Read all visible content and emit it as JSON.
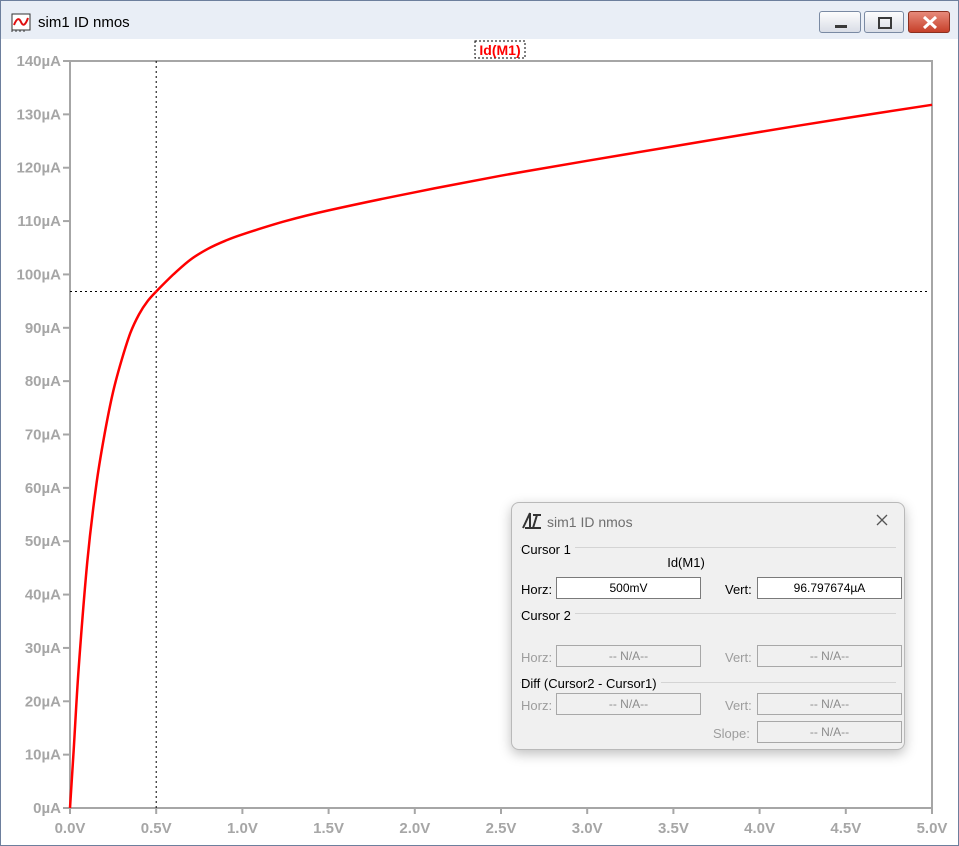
{
  "window": {
    "title": "sim1 ID nmos",
    "icon": "waveform-viewer-icon"
  },
  "plot": {
    "trace_label": "Id(M1)",
    "trace_color": "#ff0000",
    "tick_color": "#a6a6a6",
    "cursor": {
      "x": 0.5,
      "y": 96.797674
    }
  },
  "chart_data": {
    "type": "line",
    "xlim": [
      0,
      5
    ],
    "ylim": [
      0,
      140
    ],
    "x_ticks": [
      "0.0V",
      "0.5V",
      "1.0V",
      "1.5V",
      "2.0V",
      "2.5V",
      "3.0V",
      "3.5V",
      "4.0V",
      "4.5V",
      "5.0V"
    ],
    "y_ticks": [
      "0µA",
      "10µA",
      "20µA",
      "30µA",
      "40µA",
      "50µA",
      "60µA",
      "70µA",
      "80µA",
      "90µA",
      "100µA",
      "110µA",
      "120µA",
      "130µA",
      "140µA"
    ],
    "grid": false,
    "series": [
      {
        "name": "Id(M1)",
        "color": "#ff0000",
        "x": [
          0,
          0.02,
          0.05,
          0.1,
          0.15,
          0.2,
          0.25,
          0.3,
          0.35,
          0.4,
          0.45,
          0.5,
          0.6,
          0.7,
          0.8,
          0.9,
          1.0,
          1.25,
          1.5,
          2.0,
          2.5,
          3.0,
          3.5,
          4.0,
          4.5,
          5.0
        ],
        "values": [
          0,
          10,
          26,
          46,
          60,
          70,
          78,
          84,
          89,
          92.5,
          95,
          96.8,
          100,
          102.8,
          104.8,
          106.3,
          107.5,
          110,
          112,
          115.4,
          118.5,
          121.3,
          124,
          126.7,
          129.3,
          131.8
        ]
      }
    ]
  },
  "cursor_dialog": {
    "title": "sim1 ID nmos",
    "cursor1": {
      "label": "Cursor 1",
      "trace": "Id(M1)",
      "horz_label": "Horz:",
      "horz_value": "500mV",
      "vert_label": "Vert:",
      "vert_value": "96.797674µA"
    },
    "cursor2": {
      "label": "Cursor 2",
      "horz_label": "Horz:",
      "horz_value": "-- N/A--",
      "vert_label": "Vert:",
      "vert_value": "-- N/A--"
    },
    "diff": {
      "label": "Diff (Cursor2 - Cursor1)",
      "horz_label": "Horz:",
      "horz_value": "-- N/A--",
      "vert_label": "Vert:",
      "vert_value": "-- N/A--",
      "slope_label": "Slope:",
      "slope_value": "-- N/A--"
    }
  }
}
